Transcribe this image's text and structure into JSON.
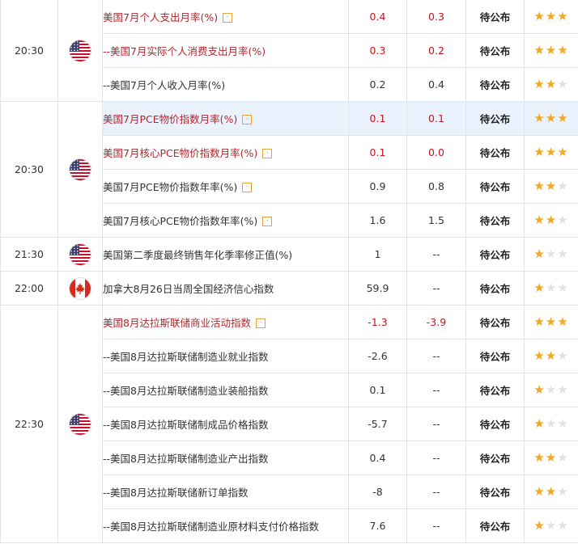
{
  "colors": {
    "accent_red": "#c8141e",
    "star_on": "#f5a623",
    "star_off": "#e2e2e2",
    "tag_orange": "#e6a23c",
    "row_highlight": "#eaf2fd",
    "border": "#e3e3e3"
  },
  "groups": [
    {
      "time": "20:30",
      "flag": "us-flag-icon",
      "rows": [
        {
          "name": "美国7月个人支出月率(%)",
          "tag": "-",
          "prev": "0.4",
          "forecast": "0.3",
          "actual": "待公布",
          "stars": 3,
          "highlight": true
        },
        {
          "name": "--美国7月实际个人消费支出月率(%)",
          "tag": "",
          "prev": "0.3",
          "forecast": "0.2",
          "actual": "待公布",
          "stars": 3,
          "highlight": true
        },
        {
          "name": "--美国7月个人收入月率(%)",
          "tag": "",
          "prev": "0.2",
          "forecast": "0.4",
          "actual": "待公布",
          "stars": 2,
          "highlight": false
        }
      ]
    },
    {
      "time": "20:30",
      "flag": "us-flag-icon",
      "rows": [
        {
          "name": "美国7月PCE物价指数月率(%)",
          "tag": "-",
          "prev": "0.1",
          "forecast": "0.1",
          "actual": "待公布",
          "stars": 3,
          "highlight": true,
          "selected": true
        },
        {
          "name": "美国7月核心PCE物价指数月率(%)",
          "tag": "-",
          "prev": "0.1",
          "forecast": "0.0",
          "actual": "待公布",
          "stars": 3,
          "highlight": true
        },
        {
          "name": "美国7月PCE物价指数年率(%)",
          "tag": "-",
          "prev": "0.9",
          "forecast": "0.8",
          "actual": "待公布",
          "stars": 2,
          "highlight": false
        },
        {
          "name": "美国7月核心PCE物价指数年率(%)",
          "tag": "-",
          "prev": "1.6",
          "forecast": "1.5",
          "actual": "待公布",
          "stars": 2,
          "highlight": false
        }
      ]
    },
    {
      "time": "21:30",
      "flag": "us-flag-icon",
      "rows": [
        {
          "name": "美国第二季度最终销售年化季率修正值(%)",
          "tag": "",
          "prev": "1",
          "forecast": "--",
          "actual": "待公布",
          "stars": 1,
          "highlight": false
        }
      ]
    },
    {
      "time": "22:00",
      "flag": "canada-flag-icon",
      "rows": [
        {
          "name": "加拿大8月26日当周全国经济信心指数",
          "tag": "",
          "prev": "59.9",
          "forecast": "--",
          "actual": "待公布",
          "stars": 1,
          "highlight": false
        }
      ]
    },
    {
      "time": "22:30",
      "flag": "us-flag-icon",
      "rows": [
        {
          "name": "美国8月达拉斯联储商业活动指数",
          "tag": "-",
          "prev": "-1.3",
          "forecast": "-3.9",
          "actual": "待公布",
          "stars": 3,
          "highlight": true
        },
        {
          "name": "--美国8月达拉斯联储制造业就业指数",
          "tag": "",
          "prev": "-2.6",
          "forecast": "--",
          "actual": "待公布",
          "stars": 2,
          "highlight": false
        },
        {
          "name": "--美国8月达拉斯联储制造业装船指数",
          "tag": "",
          "prev": "0.1",
          "forecast": "--",
          "actual": "待公布",
          "stars": 1,
          "highlight": false
        },
        {
          "name": "--美国8月达拉斯联储制成品价格指数",
          "tag": "",
          "prev": "-5.7",
          "forecast": "--",
          "actual": "待公布",
          "stars": 1,
          "highlight": false
        },
        {
          "name": "--美国8月达拉斯联储制造业产出指数",
          "tag": "",
          "prev": "0.4",
          "forecast": "--",
          "actual": "待公布",
          "stars": 2,
          "highlight": false
        },
        {
          "name": "--美国8月达拉斯联储新订单指数",
          "tag": "",
          "prev": "-8",
          "forecast": "--",
          "actual": "待公布",
          "stars": 2,
          "highlight": false
        },
        {
          "name": "--美国8月达拉斯联储制造业原材料支付价格指数",
          "tag": "",
          "prev": "7.6",
          "forecast": "--",
          "actual": "待公布",
          "stars": 1,
          "highlight": false
        }
      ]
    }
  ]
}
